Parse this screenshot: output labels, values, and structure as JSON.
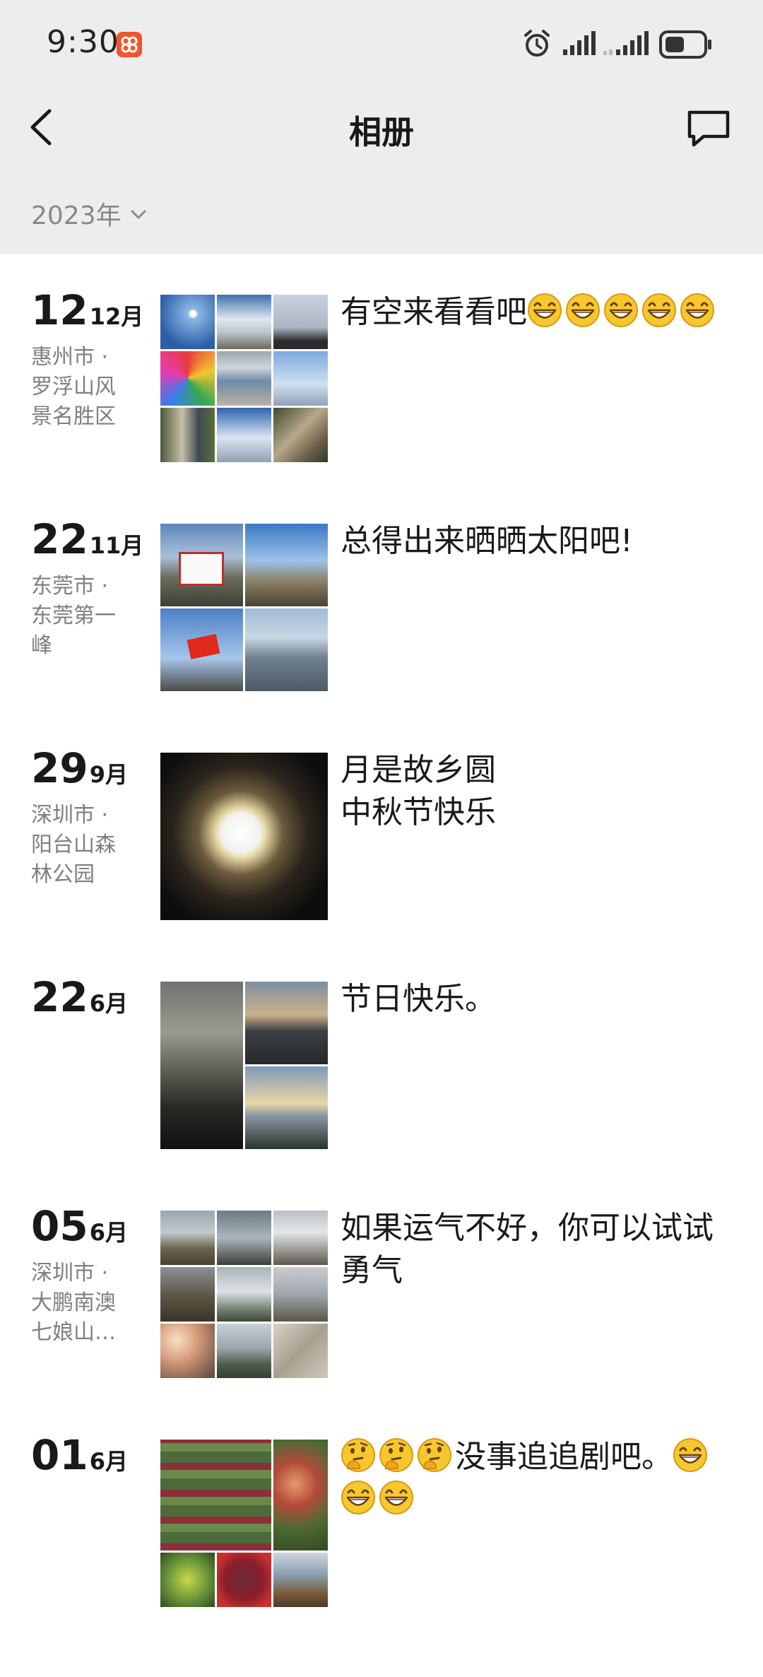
{
  "status_bar": {
    "time": "9:30"
  },
  "header": {
    "title": "相册"
  },
  "filter": {
    "year": "2023年"
  },
  "posts": [
    {
      "day": "12",
      "month": "12月",
      "location": "惠州市 · 罗浮山风景名胜区",
      "caption_text": "有空来看看吧",
      "emoji_after": 5
    },
    {
      "day": "22",
      "month": "11月",
      "location": "东莞市 · 东莞第一峰",
      "caption_text": "总得出来晒晒太阳吧!"
    },
    {
      "day": "29",
      "month": "9月",
      "location": "深圳市 · 阳台山森林公园",
      "caption_line1": "月是故乡圆",
      "caption_line2": "中秋节快乐"
    },
    {
      "day": "22",
      "month": "6月",
      "location": "",
      "caption_text": "节日快乐。"
    },
    {
      "day": "05",
      "month": "6月",
      "location": "深圳市 · 大鹏南澳七娘山…",
      "caption_text": "如果运气不好，你可以试试勇气"
    },
    {
      "day": "01",
      "month": "6月",
      "location": "",
      "caption_text": "没事追追剧吧。",
      "emoji_before": 3,
      "emoji_after": 3
    }
  ],
  "icons": {
    "back": "chevron-left-icon",
    "message": "chat-bubble-icon",
    "year_dropdown": "chevron-down-icon",
    "emoji_grin": "grinning-face-emoji",
    "emoji_think": "thinking-face-emoji"
  },
  "colors": {
    "header_bg": "#ededed",
    "muted_text": "#888888",
    "location_text": "#7f7f7f"
  }
}
